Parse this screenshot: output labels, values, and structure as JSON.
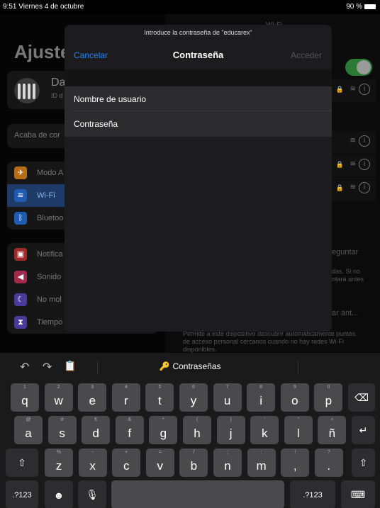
{
  "status": {
    "time": "9:51  Viernes 4 de octubre",
    "battery": "90 %"
  },
  "settings": {
    "title": "Ajuste",
    "profile_name": "Da",
    "profile_sub": "ID d",
    "suggestion": "Acaba de cor",
    "items": [
      {
        "label": "Modo A",
        "icon": "airplane-icon",
        "color": "#b66d16"
      },
      {
        "label": "Wi-Fi",
        "icon": "wifi-icon",
        "color": "#1f5bb0"
      },
      {
        "label": "Bluetoo",
        "icon": "bluetooth-icon",
        "color": "#1f5bb0"
      },
      {
        "label": "Notifica",
        "icon": "notifications-icon",
        "color": "#a02a2a"
      },
      {
        "label": "Sonido",
        "icon": "sound-icon",
        "color": "#a02a4a"
      },
      {
        "label": "No mol",
        "icon": "moon-icon",
        "color": "#4a3a9a"
      },
      {
        "label": "Tiempo",
        "icon": "hourglass-icon",
        "color": "#4a3a9a"
      }
    ],
    "right_title": "Wi-Fi",
    "ask_join": "eguntar",
    "ask_text_1": "das. Si no",
    "ask_text_2": "ntará antes",
    "hotspot": "ar ant...",
    "hotspot_desc_1": "Permite a este dispositivo descubrir automáticamente puntos",
    "hotspot_desc_2": "de acceso personal cercanos cuando no hay redes Wi-Fi",
    "hotspot_desc_3": "disponibles."
  },
  "modal": {
    "prompt": "Introduce la contraseña de \"educarex\"",
    "cancel": "Cancelar",
    "title": "Contraseña",
    "accept": "Acceder",
    "username_placeholder": "Nombre de usuario",
    "password_placeholder": "Contraseña"
  },
  "keyboard": {
    "passwords_label": "Contraseñas",
    "row1": [
      {
        "sub": "1",
        "main": "q"
      },
      {
        "sub": "2",
        "main": "w"
      },
      {
        "sub": "3",
        "main": "e"
      },
      {
        "sub": "4",
        "main": "r"
      },
      {
        "sub": "5",
        "main": "t"
      },
      {
        "sub": "6",
        "main": "y"
      },
      {
        "sub": "7",
        "main": "u"
      },
      {
        "sub": "8",
        "main": "i"
      },
      {
        "sub": "9",
        "main": "o"
      },
      {
        "sub": "0",
        "main": "p"
      }
    ],
    "row2": [
      {
        "sub": "@",
        "main": "a"
      },
      {
        "sub": "#",
        "main": "s"
      },
      {
        "sub": "€",
        "main": "d"
      },
      {
        "sub": "&",
        "main": "f"
      },
      {
        "sub": "*",
        "main": "g"
      },
      {
        "sub": "(",
        "main": "h"
      },
      {
        "sub": ")",
        "main": "j"
      },
      {
        "sub": "'",
        "main": "k"
      },
      {
        "sub": "\"",
        "main": "l"
      },
      {
        "sub": "+",
        "main": "ñ"
      }
    ],
    "row3": [
      {
        "sub": "%",
        "main": "z"
      },
      {
        "sub": "-",
        "main": "x"
      },
      {
        "sub": "+",
        "main": "c"
      },
      {
        "sub": "=",
        "main": "v"
      },
      {
        "sub": "/",
        "main": "b"
      },
      {
        "sub": ";",
        "main": "n"
      },
      {
        "sub": ":",
        "main": "m"
      },
      {
        "sub": "!",
        "main": ","
      },
      {
        "sub": "?",
        "main": "."
      }
    ],
    "numbers_left": ".?123",
    "numbers_right": ".?123",
    "delete_symbol": "⌫",
    "return_symbol": "↵",
    "shift_symbol": "⇧",
    "emoji_symbol": "☻",
    "mic_symbol": "🎙",
    "dismiss_symbol": "⌨",
    "undo_symbol": "↶",
    "redo_symbol": "↷",
    "paste_symbol": "📋"
  }
}
